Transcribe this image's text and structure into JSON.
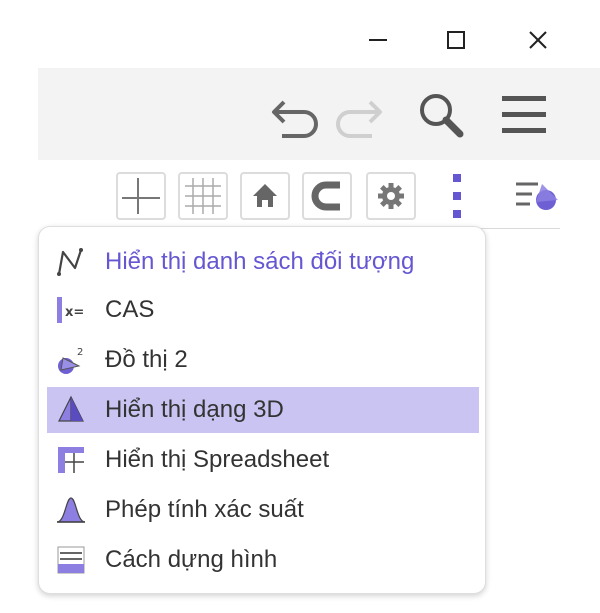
{
  "window": {
    "icons": [
      "minimize-icon",
      "maximize-icon",
      "close-icon"
    ]
  },
  "header": {
    "icons": [
      "undo-icon",
      "redo-icon",
      "search-icon",
      "menu-icon"
    ]
  },
  "graphics_toolbar": {
    "icons": [
      "axes-icon",
      "grid-icon",
      "home-icon",
      "magnet-icon",
      "settings-icon",
      "more-vertical-icon",
      "algebra-style-icon"
    ]
  },
  "colors": {
    "accent": "#6557d2",
    "selected_bg": "#c9c4f2",
    "icon_gray": "#666666",
    "text": "#333333"
  },
  "view_menu": {
    "items": [
      {
        "label": "Hiển thị danh sách đối tượng",
        "icon": "algebra-view-icon"
      },
      {
        "label": "CAS",
        "icon": "cas-icon"
      },
      {
        "label": "Đồ thị 2",
        "icon": "graphics2-icon"
      },
      {
        "label": "Hiển thị dạng 3D",
        "icon": "3d-graphics-icon",
        "selected": true
      },
      {
        "label": "Hiển thị Spreadsheet",
        "icon": "spreadsheet-icon"
      },
      {
        "label": "Phép tính xác suất",
        "icon": "probability-icon"
      },
      {
        "label": "Cách dựng hình",
        "icon": "construction-protocol-icon"
      }
    ]
  }
}
